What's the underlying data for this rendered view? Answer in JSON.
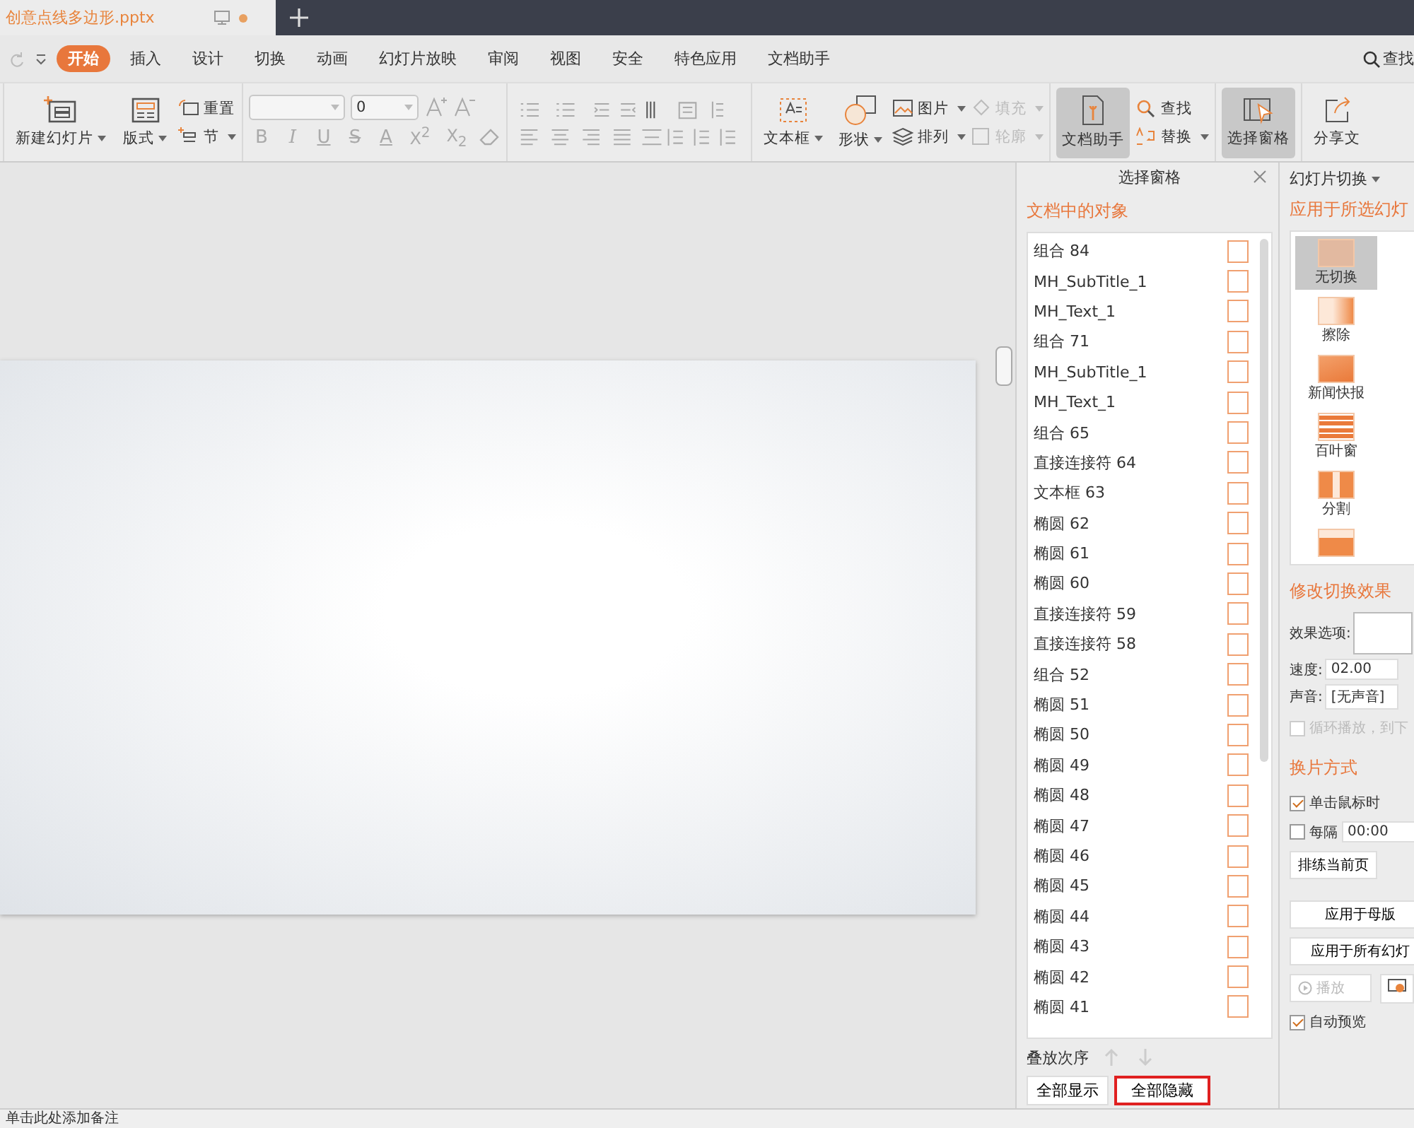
{
  "doc_tab": {
    "title": "创意点线多边形.pptx",
    "unsaved": true
  },
  "menu": {
    "tabs": [
      {
        "label": "开始",
        "selected": true
      },
      {
        "label": "插入",
        "selected": false
      },
      {
        "label": "设计",
        "selected": false
      },
      {
        "label": "切换",
        "selected": false
      },
      {
        "label": "动画",
        "selected": false
      },
      {
        "label": "幻灯片放映",
        "selected": false
      },
      {
        "label": "审阅",
        "selected": false
      },
      {
        "label": "视图",
        "selected": false
      },
      {
        "label": "安全",
        "selected": false
      },
      {
        "label": "特色应用",
        "selected": false
      },
      {
        "label": "文档助手",
        "selected": false
      }
    ],
    "search": "查找"
  },
  "ribbon": {
    "slides": {
      "new_slide": "新建幻灯片",
      "layout": "版式",
      "reset": "重置",
      "section": "节"
    },
    "font": {
      "size": "0"
    },
    "format_buttons": [
      {
        "label": "B",
        "disabled": true
      },
      {
        "label": "I",
        "disabled": true
      },
      {
        "label": "U",
        "disabled": true
      },
      {
        "label": "S",
        "disabled": true
      },
      {
        "label": "A",
        "disabled": true
      },
      {
        "label": "X$^{2}$",
        "disabled": true
      },
      {
        "label": "X$_{2}$",
        "disabled": true
      }
    ],
    "insert": {
      "textbox": "文本框",
      "shape": "形状",
      "picture": "图片",
      "arrange": "排列",
      "fill": {
        "label": "填充",
        "disabled": true
      },
      "outline": {
        "label": "轮廓",
        "disabled": true
      }
    },
    "assist": {
      "label": "文档助手",
      "selected": true
    },
    "find": "查找",
    "replace": "替换",
    "selection_pane": {
      "label": "选择窗格",
      "selected": true
    },
    "share": "分享文"
  },
  "selection_pane": {
    "title": "选择窗格",
    "section": "文档中的对象",
    "objects": [
      {
        "name": "组合 84",
        "visible": false
      },
      {
        "name": "MH_SubTitle_1",
        "visible": false
      },
      {
        "name": "MH_Text_1",
        "visible": false
      },
      {
        "name": "组合 71",
        "visible": false
      },
      {
        "name": "MH_SubTitle_1",
        "visible": false
      },
      {
        "name": "MH_Text_1",
        "visible": false
      },
      {
        "name": "组合 65",
        "visible": false
      },
      {
        "name": "直接连接符 64",
        "visible": false
      },
      {
        "name": "文本框 63",
        "visible": false
      },
      {
        "name": "椭圆 62",
        "visible": false
      },
      {
        "name": "椭圆 61",
        "visible": false
      },
      {
        "name": "椭圆 60",
        "visible": false
      },
      {
        "name": "直接连接符 59",
        "visible": false
      },
      {
        "name": "直接连接符 58",
        "visible": false
      },
      {
        "name": "组合 52",
        "visible": false
      },
      {
        "name": "椭圆 51",
        "visible": false
      },
      {
        "name": "椭圆 50",
        "visible": false
      },
      {
        "name": "椭圆 49",
        "visible": false
      },
      {
        "name": "椭圆 48",
        "visible": false
      },
      {
        "name": "椭圆 47",
        "visible": false
      },
      {
        "name": "椭圆 46",
        "visible": false
      },
      {
        "name": "椭圆 45",
        "visible": false
      },
      {
        "name": "椭圆 44",
        "visible": false
      },
      {
        "name": "椭圆 43",
        "visible": false
      },
      {
        "name": "椭圆 42",
        "visible": false
      },
      {
        "name": "椭圆 41",
        "visible": false
      }
    ],
    "order_label": "叠放次序",
    "buttons": [
      {
        "label": "全部显示",
        "highlighted": false
      },
      {
        "label": "全部隐藏",
        "highlighted": true
      }
    ]
  },
  "transition_pane": {
    "title": "幻灯片切换",
    "apply_heading": "应用于所选幻灯",
    "transitions": [
      {
        "label": "无切换",
        "selected": true,
        "kind": "none"
      },
      {
        "label": "擦除",
        "selected": false,
        "kind": "wipe"
      },
      {
        "label": "新闻快报",
        "selected": false,
        "kind": "news"
      },
      {
        "label": "百叶窗",
        "selected": false,
        "kind": "blinds"
      },
      {
        "label": "分割",
        "selected": false,
        "kind": "split"
      },
      {
        "selected": false,
        "kind": "push"
      }
    ],
    "modify_heading": "修改切换效果",
    "effect_label": "效果选项:",
    "speed_label": "速度:",
    "speed": "02.00",
    "sound_label": "声音:",
    "sound": "[无声音]",
    "loop": {
      "label": "循环播放，到下",
      "checked": false,
      "disabled": true
    },
    "advance_heading": "换片方式",
    "on_click": {
      "label": "单击鼠标时",
      "checked": true
    },
    "every": {
      "label": "每隔",
      "checked": false,
      "value": "00:00"
    },
    "rehearse": "排练当前页",
    "apply_master": "应用于母版",
    "apply_all": "应用于所有幻灯",
    "play": {
      "label": "播放",
      "disabled": true
    },
    "auto_preview": {
      "label": "自动预览",
      "checked": true
    }
  },
  "notes": {
    "placeholder": "单击此处添加备注"
  }
}
